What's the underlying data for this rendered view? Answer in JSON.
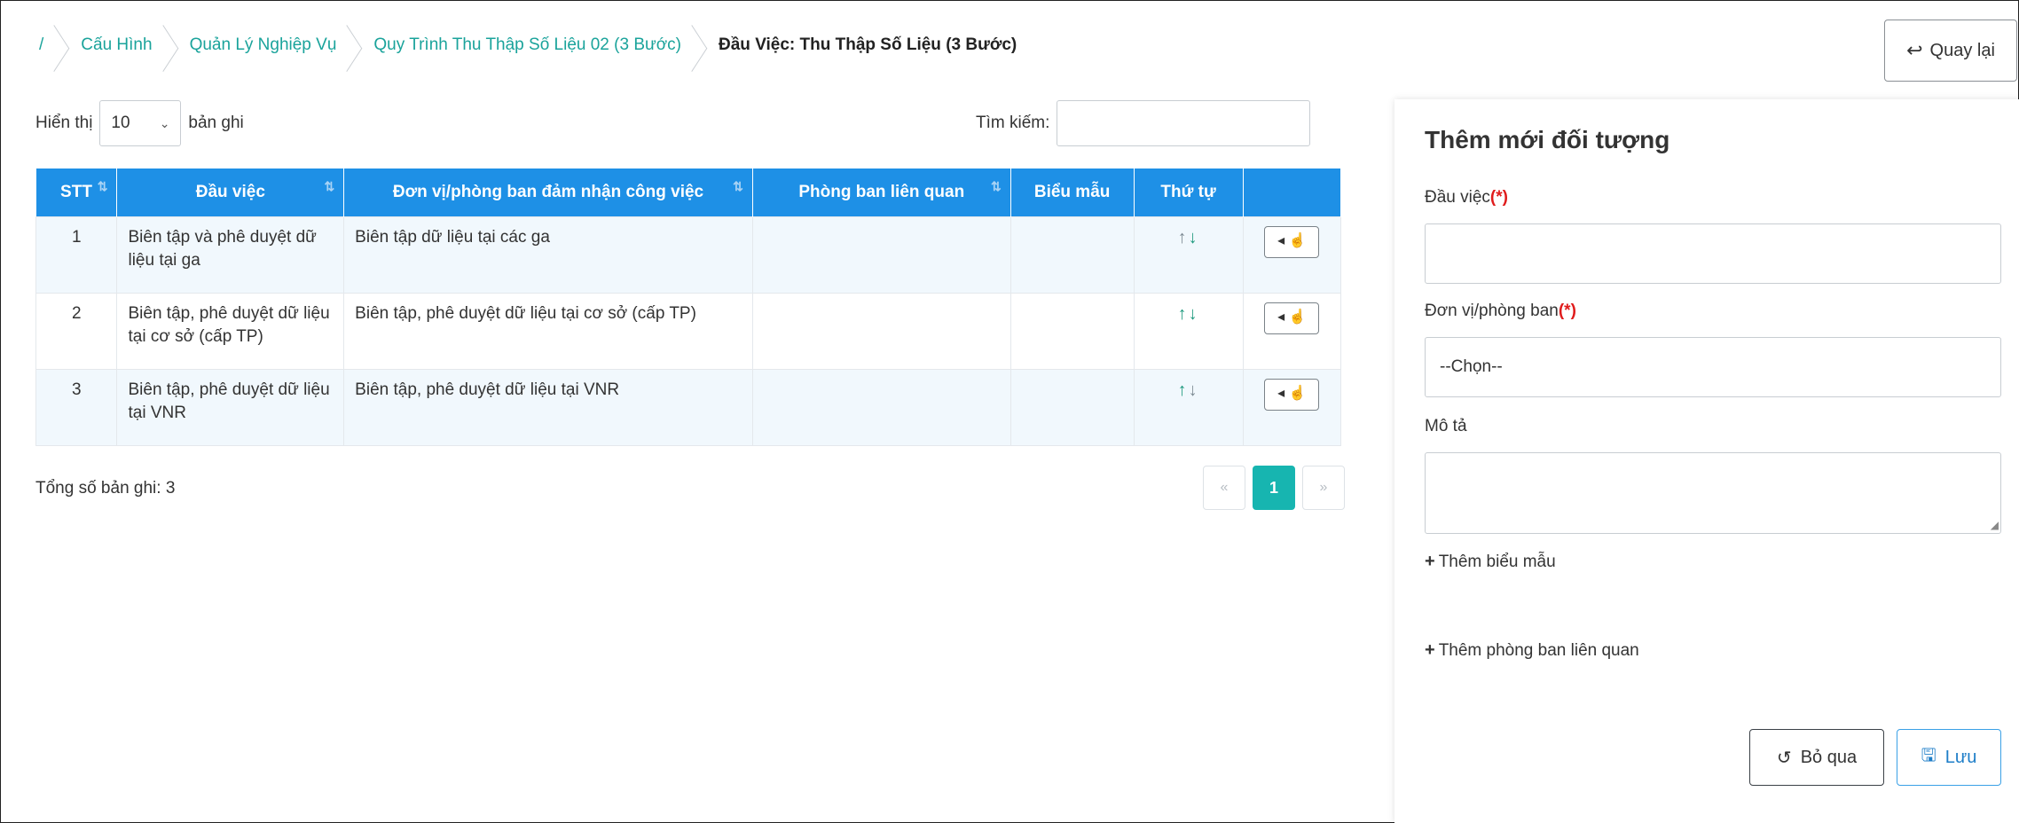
{
  "breadcrumb": {
    "root": "/",
    "items": [
      "Cấu Hình",
      "Quản Lý Nghiệp Vụ",
      "Quy Trình Thu Thập Số Liệu 02 (3 Bước)"
    ],
    "current": "Đầu Việc: Thu Thập Số Liệu (3 Bước)"
  },
  "back_button": {
    "label": "Quay lại",
    "icon": "return-icon"
  },
  "list": {
    "show_label": "Hiển thị",
    "page_size": "10",
    "records_label": "bản ghi",
    "search_label": "Tìm kiếm:",
    "search_value": "",
    "columns": [
      "STT",
      "Đầu việc",
      "Đơn vị/phòng ban đảm nhận công việc",
      "Phòng ban liên quan",
      "Biểu mẫu",
      "Thứ tự",
      ""
    ],
    "rows": [
      {
        "stt": "1",
        "task": "Biên tập và phê duyệt dữ liệu tại ga",
        "unit": "Biên tập dữ liệu tại các ga",
        "related": "",
        "form": ""
      },
      {
        "stt": "2",
        "task": "Biên tập, phê duyệt dữ liệu tại cơ sở (cấp TP)",
        "unit": "Biên tập, phê duyệt dữ liệu tại cơ sở (cấp TP)",
        "related": "",
        "form": ""
      },
      {
        "stt": "3",
        "task": "Biên tập, phê duyệt dữ liệu tại VNR",
        "unit": "Biên tập, phê duyệt dữ liệu tại VNR",
        "related": "",
        "form": ""
      }
    ],
    "total_label": "Tổng số bản ghi: 3",
    "pager": {
      "prev": "«",
      "current": "1",
      "next": "»"
    }
  },
  "form": {
    "title": "Thêm mới đối tượng",
    "task_label": "Đầu việc",
    "required_mark": "(*)",
    "task_value": "",
    "unit_label": "Đơn vị/phòng ban",
    "unit_value": "--Chọn--",
    "desc_label": "Mô tả",
    "desc_value": "",
    "add_form_label": "Thêm biểu mẫu",
    "add_related_label": "Thêm phòng ban liên quan",
    "cancel_label": "Bỏ qua",
    "save_label": "Lưu"
  },
  "colors": {
    "header_blue": "#1e90e6",
    "teal": "#17b5b0",
    "breadcrumb_link": "#1aa39b",
    "required": "#e01c1c"
  }
}
